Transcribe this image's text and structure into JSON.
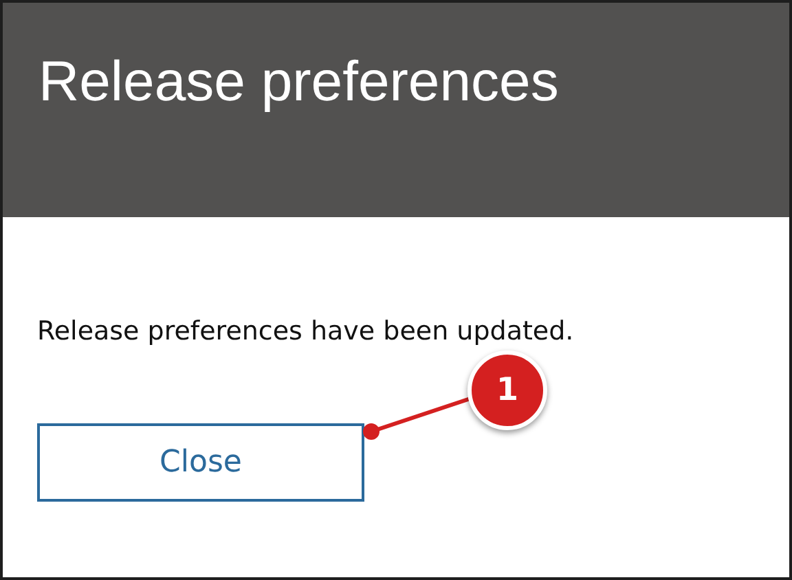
{
  "dialog": {
    "title": "Release preferences",
    "message": "Release preferences have been updated.",
    "buttons": [
      "Close"
    ]
  },
  "callout": {
    "number": "1"
  }
}
